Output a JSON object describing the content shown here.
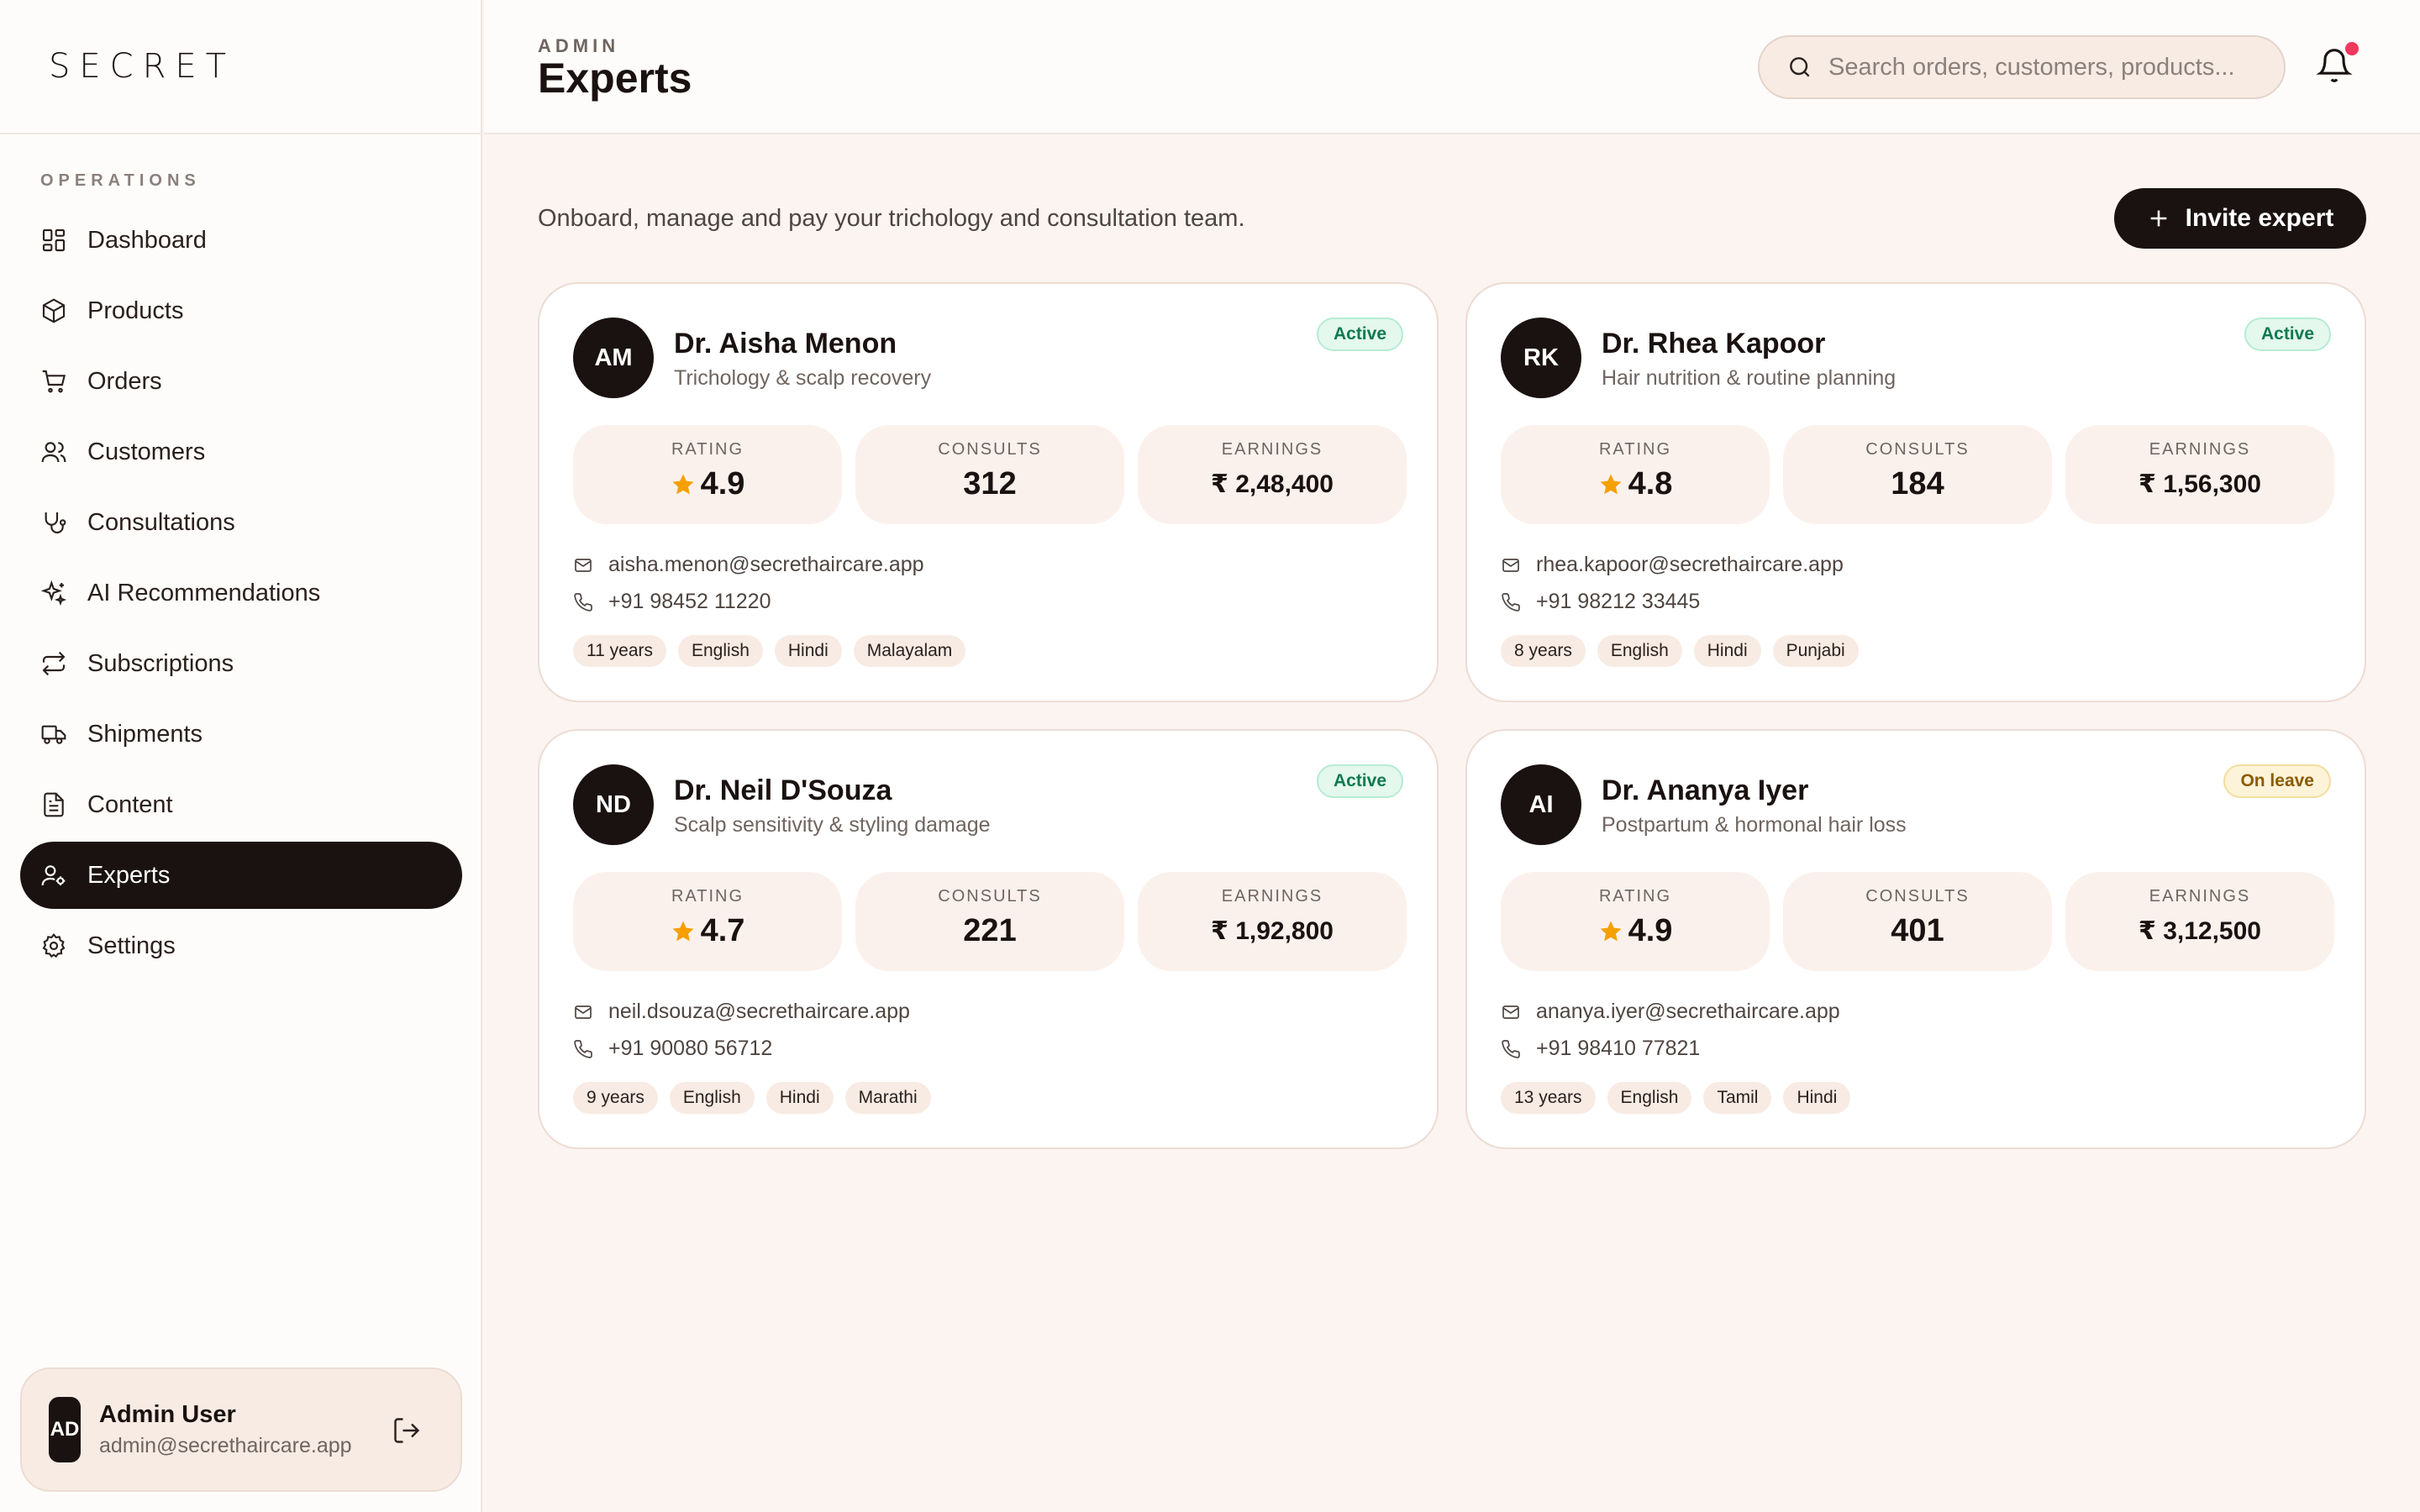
{
  "brand": {
    "logo": "SECRET"
  },
  "sidebar": {
    "section_label": "OPERATIONS",
    "items": [
      {
        "label": "Dashboard",
        "icon": "dashboard-icon"
      },
      {
        "label": "Products",
        "icon": "box-icon"
      },
      {
        "label": "Orders",
        "icon": "cart-icon"
      },
      {
        "label": "Customers",
        "icon": "users-icon"
      },
      {
        "label": "Consultations",
        "icon": "stethoscope-icon"
      },
      {
        "label": "AI Recommendations",
        "icon": "sparkles-icon"
      },
      {
        "label": "Subscriptions",
        "icon": "repeat-icon"
      },
      {
        "label": "Shipments",
        "icon": "truck-icon"
      },
      {
        "label": "Content",
        "icon": "document-icon"
      },
      {
        "label": "Experts",
        "icon": "user-cog-icon",
        "active": true
      },
      {
        "label": "Settings",
        "icon": "gear-icon"
      }
    ],
    "user": {
      "initials": "AD",
      "name": "Admin User",
      "email": "admin@secrethaircare.app"
    }
  },
  "header": {
    "kicker": "ADMIN",
    "title": "Experts",
    "search_placeholder": "Search orders, customers, products..."
  },
  "main": {
    "subtitle": "Onboard, manage and pay your trichology and consultation team.",
    "invite_label": "Invite expert",
    "stat_labels": {
      "rating": "RATING",
      "consults": "CONSULTS",
      "earnings": "EARNINGS"
    },
    "experts": [
      {
        "initials": "AM",
        "name": "Dr. Aisha Menon",
        "specialty": "Trichology & scalp recovery",
        "status": "Active",
        "status_type": "active",
        "rating": "4.9",
        "consults": "312",
        "earnings": "₹ 2,48,400",
        "email": "aisha.menon@secrethaircare.app",
        "phone": "+91 98452 11220",
        "tags": [
          "11 years",
          "English",
          "Hindi",
          "Malayalam"
        ]
      },
      {
        "initials": "RK",
        "name": "Dr. Rhea Kapoor",
        "specialty": "Hair nutrition & routine planning",
        "status": "Active",
        "status_type": "active",
        "rating": "4.8",
        "consults": "184",
        "earnings": "₹ 1,56,300",
        "email": "rhea.kapoor@secrethaircare.app",
        "phone": "+91 98212 33445",
        "tags": [
          "8 years",
          "English",
          "Hindi",
          "Punjabi"
        ]
      },
      {
        "initials": "ND",
        "name": "Dr. Neil D'Souza",
        "specialty": "Scalp sensitivity & styling damage",
        "status": "Active",
        "status_type": "active",
        "rating": "4.7",
        "consults": "221",
        "earnings": "₹ 1,92,800",
        "email": "neil.dsouza@secrethaircare.app",
        "phone": "+91 90080 56712",
        "tags": [
          "9 years",
          "English",
          "Hindi",
          "Marathi"
        ]
      },
      {
        "initials": "AI",
        "name": "Dr. Ananya Iyer",
        "specialty": "Postpartum & hormonal hair loss",
        "status": "On leave",
        "status_type": "leave",
        "rating": "4.9",
        "consults": "401",
        "earnings": "₹ 3,12,500",
        "email": "ananya.iyer@secrethaircare.app",
        "phone": "+91 98410 77821",
        "tags": [
          "13 years",
          "English",
          "Tamil",
          "Hindi"
        ]
      }
    ]
  },
  "colors": {
    "accent": "#1a1210",
    "background": "#fbf4f1",
    "notification": "#f0375d",
    "star": "#f5a000"
  }
}
